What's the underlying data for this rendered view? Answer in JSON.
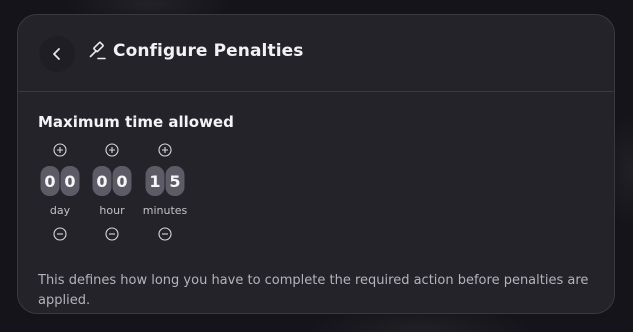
{
  "header": {
    "title": "Configure Penalties",
    "back_icon": "chevron-left-icon",
    "title_icon": "gavel-icon"
  },
  "main": {
    "section_label": "Maximum time allowed",
    "units": [
      {
        "label": "day",
        "digits": [
          "0",
          "0"
        ]
      },
      {
        "label": "hour",
        "digits": [
          "0",
          "0"
        ]
      },
      {
        "label": "minutes",
        "digits": [
          "1",
          "5"
        ]
      }
    ],
    "description": "This defines how long you have to complete the required action before penalties are applied."
  },
  "colors": {
    "background": "#15141a",
    "card": "#242329",
    "digit_bg": "#5c5b66",
    "text_primary": "#f2f2f4",
    "text_secondary": "#b4b3bb"
  }
}
